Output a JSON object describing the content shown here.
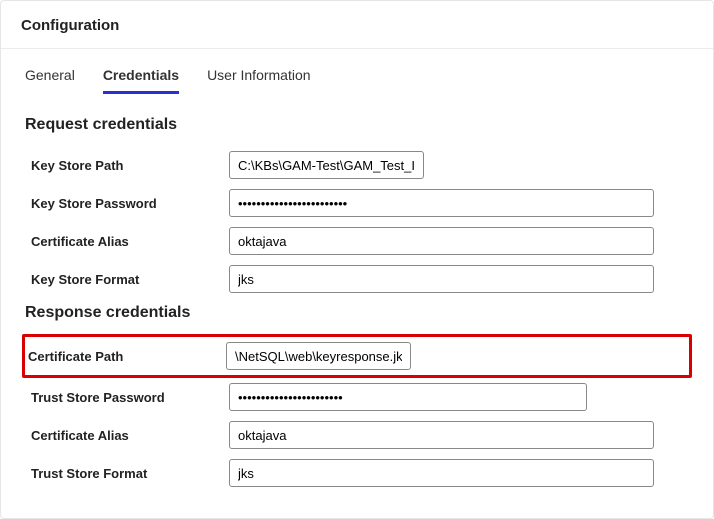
{
  "header": {
    "title": "Configuration"
  },
  "tabs": {
    "general": "General",
    "credentials": "Credentials",
    "userinfo": "User Information"
  },
  "request": {
    "title": "Request credentials",
    "keyStorePath": {
      "label": "Key Store Path",
      "value": "C:\\KBs\\GAM-Test\\GAM_Test_II"
    },
    "keyStorePassword": {
      "label": "Key Store Password",
      "value": "••••••••••••••••••••••••"
    },
    "certAlias": {
      "label": "Certificate Alias",
      "value": "oktajava"
    },
    "keyStoreFormat": {
      "label": "Key Store Format",
      "value": "jks"
    }
  },
  "response": {
    "title": "Response credentials",
    "certPath": {
      "label": "Certificate Path",
      "value": "\\NetSQL\\web\\keyresponse.jks"
    },
    "trustStorePassword": {
      "label": "Trust Store Password",
      "value": "•••••••••••••••••••••••"
    },
    "certAlias": {
      "label": "Certificate Alias",
      "value": "oktajava"
    },
    "trustStoreFormat": {
      "label": "Trust Store Format",
      "value": "jks"
    }
  }
}
